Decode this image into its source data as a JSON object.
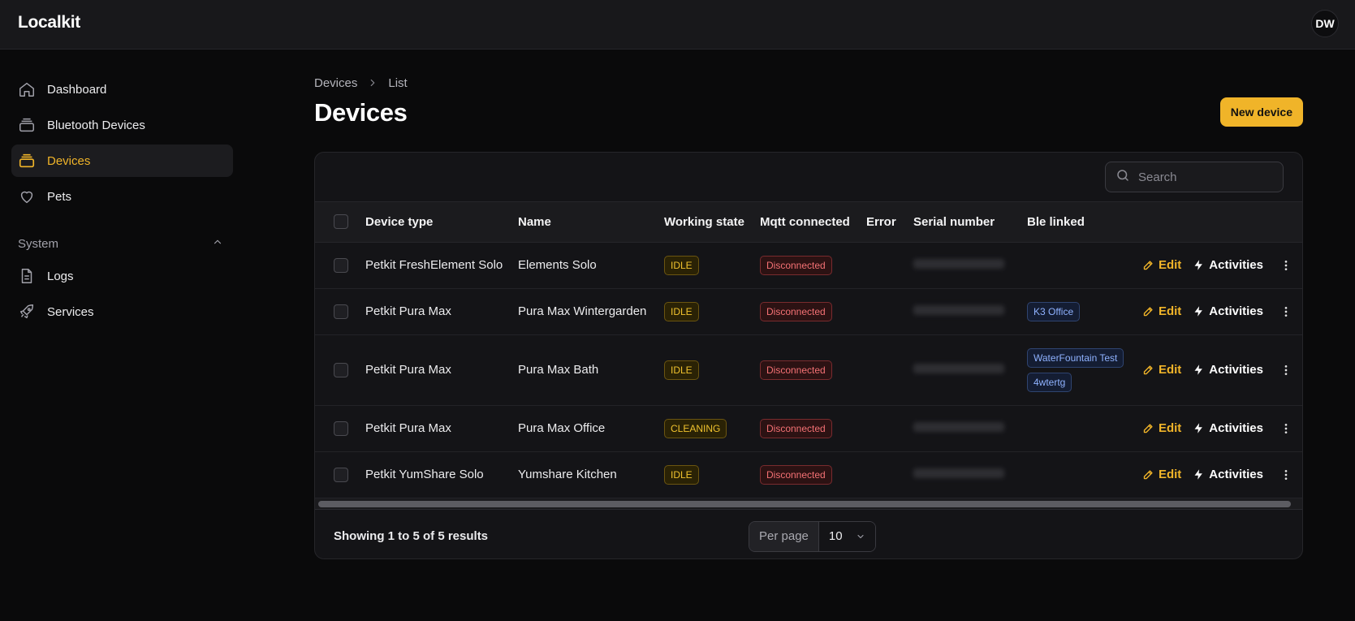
{
  "app": {
    "brand": "Localkit",
    "user_initials": "DW"
  },
  "sidebar": {
    "items": [
      {
        "label": "Dashboard",
        "icon": "home-icon"
      },
      {
        "label": "Bluetooth Devices",
        "icon": "device-stack-icon"
      },
      {
        "label": "Devices",
        "icon": "device-stack-icon",
        "active": true
      },
      {
        "label": "Pets",
        "icon": "heart-icon"
      }
    ],
    "group_label": "System",
    "group_items": [
      {
        "label": "Logs",
        "icon": "document-icon"
      },
      {
        "label": "Services",
        "icon": "rocket-icon"
      }
    ]
  },
  "breadcrumb": [
    "Devices",
    "List"
  ],
  "page_title": "Devices",
  "new_button": "New device",
  "search": {
    "placeholder": "Search",
    "value": ""
  },
  "table": {
    "columns": [
      "Device type",
      "Name",
      "Working state",
      "Mqtt connected",
      "Error",
      "Serial number",
      "Ble linked"
    ],
    "rows": [
      {
        "device_type": "Petkit FreshElement Solo",
        "name": "Elements Solo",
        "working_state": "IDLE",
        "mqtt": "Disconnected",
        "error": "",
        "ble": []
      },
      {
        "device_type": "Petkit Pura Max",
        "name": "Pura Max Wintergarden",
        "working_state": "IDLE",
        "mqtt": "Disconnected",
        "error": "",
        "ble": [
          "K3 Office"
        ]
      },
      {
        "device_type": "Petkit Pura Max",
        "name": "Pura Max Bath",
        "working_state": "IDLE",
        "mqtt": "Disconnected",
        "error": "",
        "ble": [
          "WaterFountain Test",
          "4wtertg"
        ]
      },
      {
        "device_type": "Petkit Pura Max",
        "name": "Pura Max Office",
        "working_state": "CLEANING",
        "mqtt": "Disconnected",
        "error": "",
        "ble": []
      },
      {
        "device_type": "Petkit YumShare Solo",
        "name": "Yumshare Kitchen",
        "working_state": "IDLE",
        "mqtt": "Disconnected",
        "error": "",
        "ble": []
      }
    ],
    "row_actions": {
      "edit": "Edit",
      "activities": "Activities"
    }
  },
  "footer": {
    "results": "Showing 1 to 5 of 5 results",
    "per_page_label": "Per page",
    "per_page_value": "10"
  },
  "colors": {
    "accent": "#f0b429",
    "danger": "#f47174",
    "info": "#8fb2ff",
    "background": "#0a0a0b"
  }
}
